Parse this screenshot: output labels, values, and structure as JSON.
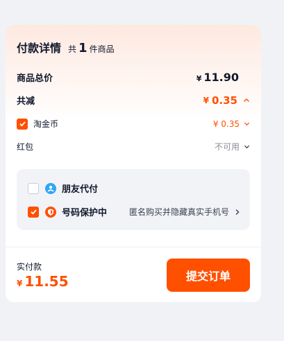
{
  "header": {
    "title": "付款详情",
    "count_prefix": "共",
    "count": "1",
    "count_suffix": "件商品"
  },
  "total": {
    "label": "商品总价",
    "currency": "¥",
    "amount": "11.90"
  },
  "discount": {
    "label": "共减",
    "currency": "¥",
    "amount": "0.35",
    "expanded": true
  },
  "coins": {
    "label": "淘金币",
    "checked": true,
    "value": "¥ 0.35"
  },
  "red_packet": {
    "label": "红包",
    "value": "不可用"
  },
  "options": {
    "friend_pay": {
      "label": "朋友代付",
      "checked": false,
      "icon": "friend-pay-icon"
    },
    "number_protect": {
      "label": "号码保护中",
      "checked": true,
      "icon": "shield-icon",
      "detail": "匿名购买并隐藏真实手机号"
    }
  },
  "footer": {
    "pay_label": "实付款",
    "currency": "¥",
    "amount": "11.55",
    "submit_label": "提交订单"
  },
  "colors": {
    "accent": "#ff5000",
    "text": "#11192d",
    "muted": "#8a8e99",
    "option_bg": "#f1f3f7",
    "page_bg": "#f0f2f6",
    "friend_icon": "#2ea7f4"
  }
}
